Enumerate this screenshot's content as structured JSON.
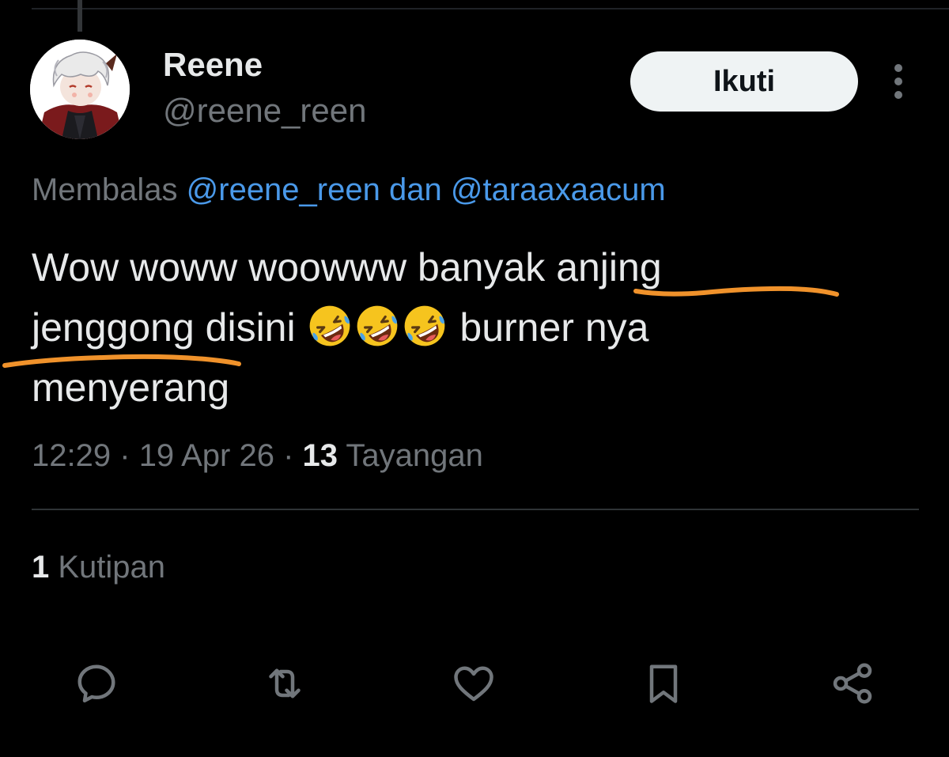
{
  "author": {
    "display_name": "Reene",
    "handle": "@reene_reen"
  },
  "follow_button": {
    "label": "Ikuti"
  },
  "reply_context": {
    "prefix": "Membalas",
    "mention_1": "@reene_reen",
    "conjunction": "dan",
    "mention_2": "@taraaxaacum"
  },
  "tweet": {
    "line_1_a": "Wow woww woowww banyak ",
    "line_1_b": "anjing",
    "line_2_a": "jenggong",
    "line_2_b": " disini ",
    "line_2_c": " burner nya",
    "line_3": "menyerang",
    "emoji": "rolling-on-the-floor-laughing",
    "emoji_count": 3
  },
  "meta": {
    "time": "12:29",
    "date": "19 Apr 26",
    "separator": "·",
    "views_count": "13",
    "views_label": "Tayangan"
  },
  "stats": {
    "quote_count": "1",
    "quote_label": "Kutipan"
  },
  "actions": [
    "reply-icon",
    "retweet-icon",
    "like-icon",
    "bookmark-icon",
    "share-icon"
  ],
  "colors": {
    "background": "#000000",
    "text_primary": "#e7e9ea",
    "text_secondary": "#71767b",
    "mention": "#4a99e9",
    "annotation_underline": "#f0922b",
    "follow_button_bg": "#eff3f4"
  }
}
